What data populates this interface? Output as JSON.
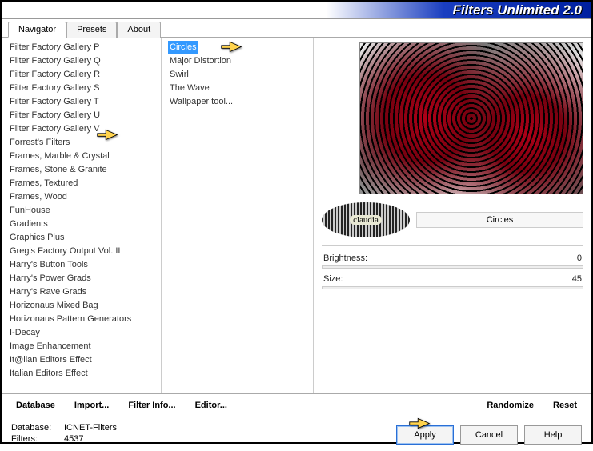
{
  "window": {
    "title": "Filters Unlimited 2.0"
  },
  "tabs": [
    {
      "label": "Navigator",
      "active": true
    },
    {
      "label": "Presets",
      "active": false
    },
    {
      "label": "About",
      "active": false
    }
  ],
  "categories": [
    "Filter Factory Gallery P",
    "Filter Factory Gallery Q",
    "Filter Factory Gallery R",
    "Filter Factory Gallery S",
    "Filter Factory Gallery T",
    "Filter Factory Gallery U",
    "Filter Factory Gallery V",
    "Forrest's Filters",
    "Frames, Marble & Crystal",
    "Frames, Stone & Granite",
    "Frames, Textured",
    "Frames, Wood",
    "FunHouse",
    "Gradients",
    "Graphics Plus",
    "Greg's Factory Output Vol. II",
    "Harry's Button Tools",
    "Harry's Power Grads",
    "Harry's Rave Grads",
    "Horizonaus Mixed Bag",
    "Horizonaus Pattern Generators",
    "I-Decay",
    "Image Enhancement",
    "It@lian Editors Effect",
    "Italian Editors Effect"
  ],
  "selected_category_index": 7,
  "filters": [
    "Circles",
    "Major Distortion",
    "Swirl",
    "The Wave",
    "Wallpaper tool..."
  ],
  "selected_filter_index": 0,
  "watermark": {
    "text": "claudia"
  },
  "current_filter_label": "Circles",
  "params": [
    {
      "label": "Brightness:",
      "value": "0"
    },
    {
      "label": "Size:",
      "value": "45"
    }
  ],
  "toolbar": {
    "database": "Database",
    "import": "Import...",
    "filterinfo": "Filter Info...",
    "editor": "Editor...",
    "randomize": "Randomize",
    "reset": "Reset"
  },
  "footer": {
    "db_label": "Database:",
    "db_value": "ICNET-Filters",
    "filters_label": "Filters:",
    "filters_value": "4537",
    "apply": "Apply",
    "cancel": "Cancel",
    "help": "Help"
  }
}
